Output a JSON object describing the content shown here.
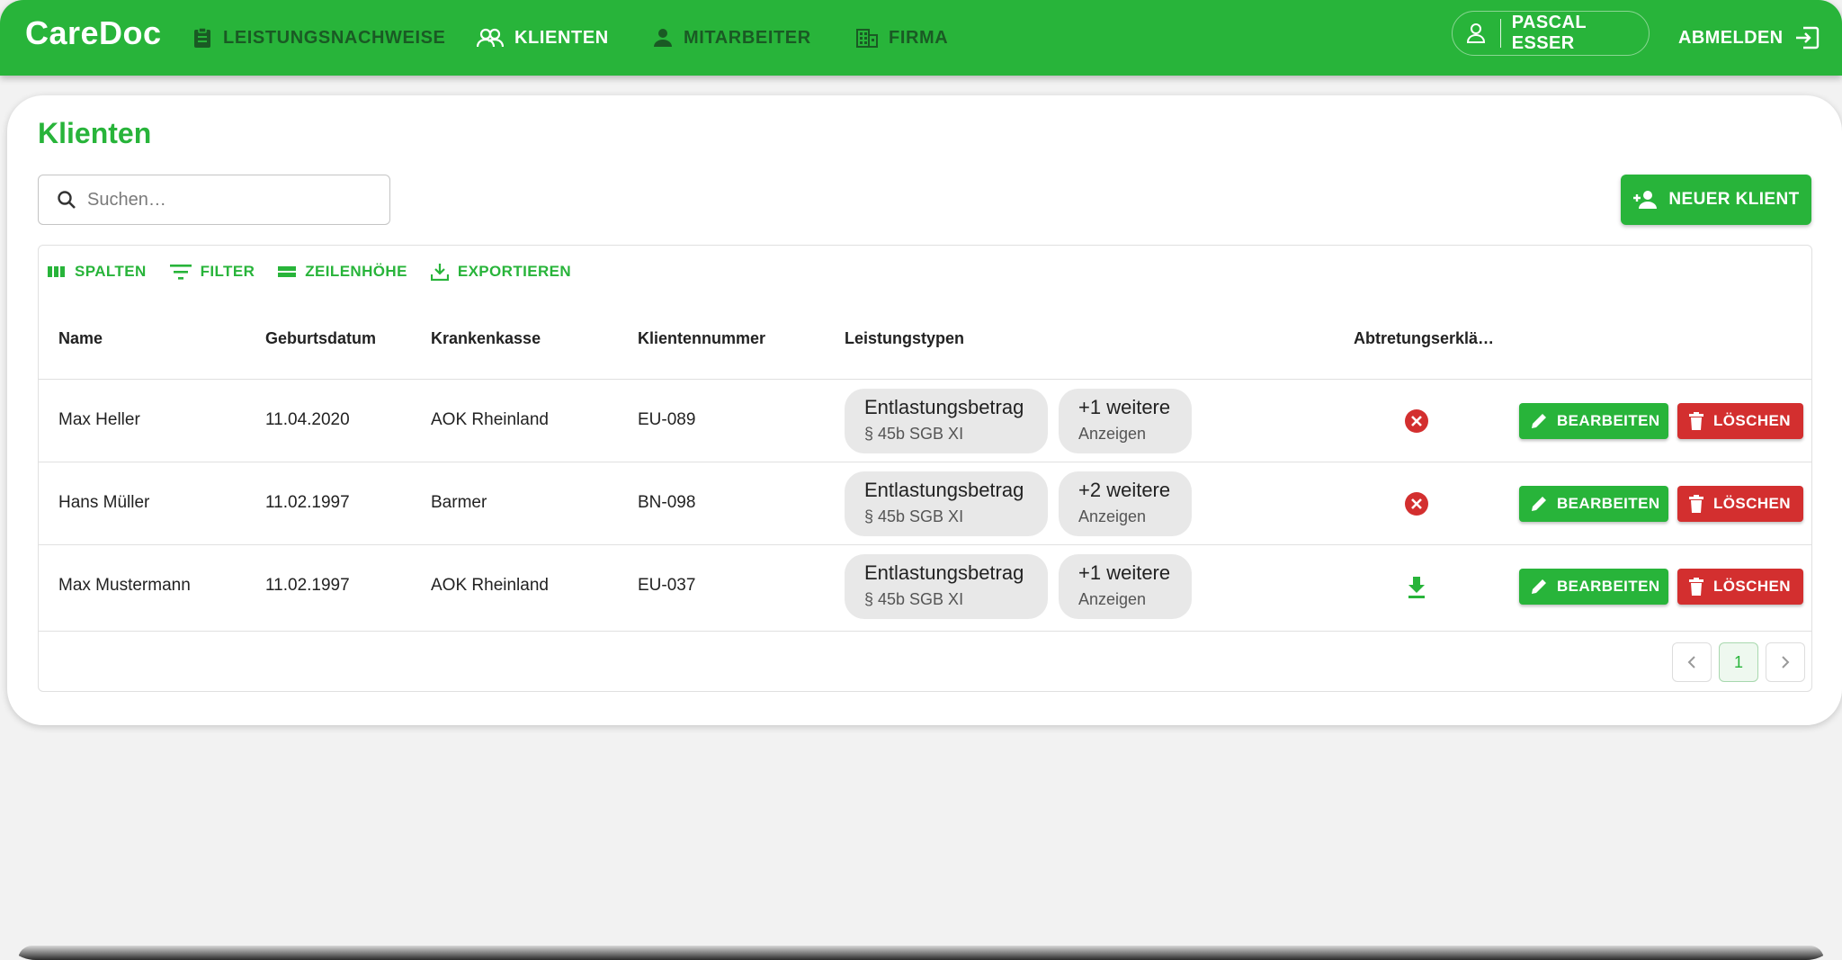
{
  "app": {
    "brand": "CareDoc"
  },
  "nav": {
    "items": [
      {
        "label": "LEISTUNGSNACHWEISE",
        "icon": "clipboard-icon",
        "active": false
      },
      {
        "label": "KLIENTEN",
        "icon": "people-icon",
        "active": true
      },
      {
        "label": "MITARBEITER",
        "icon": "person-icon",
        "active": false
      },
      {
        "label": "FIRMA",
        "icon": "building-icon",
        "active": false
      }
    ],
    "user": "PASCAL ESSER",
    "logout": "ABMELDEN"
  },
  "page": {
    "title": "Klienten",
    "search_placeholder": "Suchen…",
    "new_button": "NEUER KLIENT"
  },
  "toolbar": {
    "columns": "SPALTEN",
    "filter": "FILTER",
    "density": "ZEILENHÖHE",
    "export": "EXPORTIEREN"
  },
  "table": {
    "headers": [
      "Name",
      "Geburtsdatum",
      "Krankenkasse",
      "Klientennummer",
      "Leistungstypen",
      "Abtretungserklä…"
    ],
    "edit_label": "BEARBEITEN",
    "delete_label": "LÖSCHEN",
    "rows": [
      {
        "name": "Max Heller",
        "birthdate": "11.04.2020",
        "insurance": "AOK Rheinland",
        "client_no": "EU-089",
        "service": "Entlastungsbetrag",
        "service_sub": "§ 45b SGB XI",
        "more": "+1 weitere",
        "more_sub": "Anzeigen",
        "status": "missing"
      },
      {
        "name": "Hans Müller",
        "birthdate": "11.02.1997",
        "insurance": "Barmer",
        "client_no": "BN-098",
        "service": "Entlastungsbetrag",
        "service_sub": "§ 45b SGB XI",
        "more": "+2 weitere",
        "more_sub": "Anzeigen",
        "status": "missing"
      },
      {
        "name": "Max Mustermann",
        "birthdate": "11.02.1997",
        "insurance": "AOK Rheinland",
        "client_no": "EU-037",
        "service": "Entlastungsbetrag",
        "service_sub": "§ 45b SGB XI",
        "more": "+1 weitere",
        "more_sub": "Anzeigen",
        "status": "download"
      }
    ]
  },
  "pagination": {
    "current": "1"
  },
  "colors": {
    "primary": "#28b43a",
    "danger": "#d32f2f"
  }
}
